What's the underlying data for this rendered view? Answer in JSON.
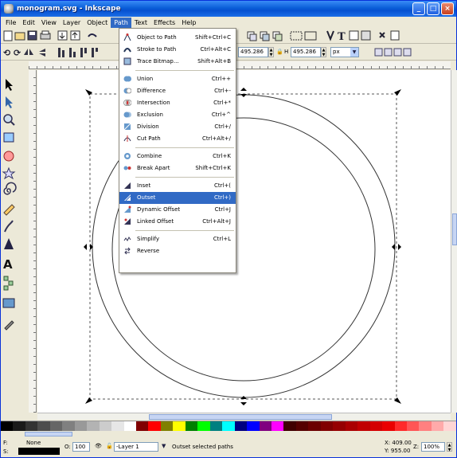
{
  "window": {
    "title": "monogram.svg - Inkscape",
    "controls": [
      "_",
      "□",
      "×"
    ]
  },
  "menubar": {
    "items": [
      "File",
      "Edit",
      "View",
      "Layer",
      "Object",
      "Path",
      "Text",
      "Effects",
      "Help"
    ],
    "active": "Path"
  },
  "path_menu": {
    "items": [
      {
        "label": "Object to Path",
        "shortcut": "Shift+Ctrl+C",
        "icon": "object-to-path-icon"
      },
      {
        "label": "Stroke to Path",
        "shortcut": "Ctrl+Alt+C",
        "icon": "stroke-to-path-icon"
      },
      {
        "label": "Trace Bitmap...",
        "shortcut": "Shift+Alt+B",
        "icon": "trace-bitmap-icon"
      },
      {
        "label": "Union",
        "shortcut": "Ctrl++",
        "icon": "union-icon"
      },
      {
        "label": "Difference",
        "shortcut": "Ctrl+-",
        "icon": "difference-icon"
      },
      {
        "label": "Intersection",
        "shortcut": "Ctrl+*",
        "icon": "intersection-icon"
      },
      {
        "label": "Exclusion",
        "shortcut": "Ctrl+^",
        "icon": "exclusion-icon"
      },
      {
        "label": "Division",
        "shortcut": "Ctrl+/",
        "icon": "division-icon"
      },
      {
        "label": "Cut Path",
        "shortcut": "Ctrl+Alt+/",
        "icon": "cut-path-icon"
      },
      {
        "label": "Combine",
        "shortcut": "Ctrl+K",
        "icon": "combine-icon"
      },
      {
        "label": "Break Apart",
        "shortcut": "Shift+Ctrl+K",
        "icon": "break-apart-icon"
      },
      {
        "label": "Inset",
        "shortcut": "Ctrl+(",
        "icon": "inset-icon"
      },
      {
        "label": "Outset",
        "shortcut": "Ctrl+)",
        "icon": "outset-icon"
      },
      {
        "label": "Dynamic Offset",
        "shortcut": "Ctrl+J",
        "icon": "dynamic-offset-icon"
      },
      {
        "label": "Linked Offset",
        "shortcut": "Ctrl+Alt+J",
        "icon": "linked-offset-icon"
      },
      {
        "label": "Simplify",
        "shortcut": "Ctrl+L",
        "icon": "simplify-icon"
      },
      {
        "label": "Reverse",
        "shortcut": "",
        "icon": "reverse-icon"
      }
    ],
    "highlighted": "Outset"
  },
  "toolbar": {
    "w_value": "495.286",
    "h_label": "H",
    "h_value": "495.286",
    "unit": "px"
  },
  "statusbar": {
    "fill_label": "F:",
    "fill_value": "None",
    "stroke_label": "S:",
    "opacity_label": "O:",
    "opacity_value": "100",
    "layer": "-Layer 1",
    "message": "Outset selected paths",
    "x_coord": "X: 409.00",
    "y_coord": "Y: 955.00",
    "zoom_label": "Z:",
    "zoom_value": "100%"
  },
  "colors": {
    "menu_highlight": "#316ac5",
    "titlebar": "#0a5fd8"
  }
}
